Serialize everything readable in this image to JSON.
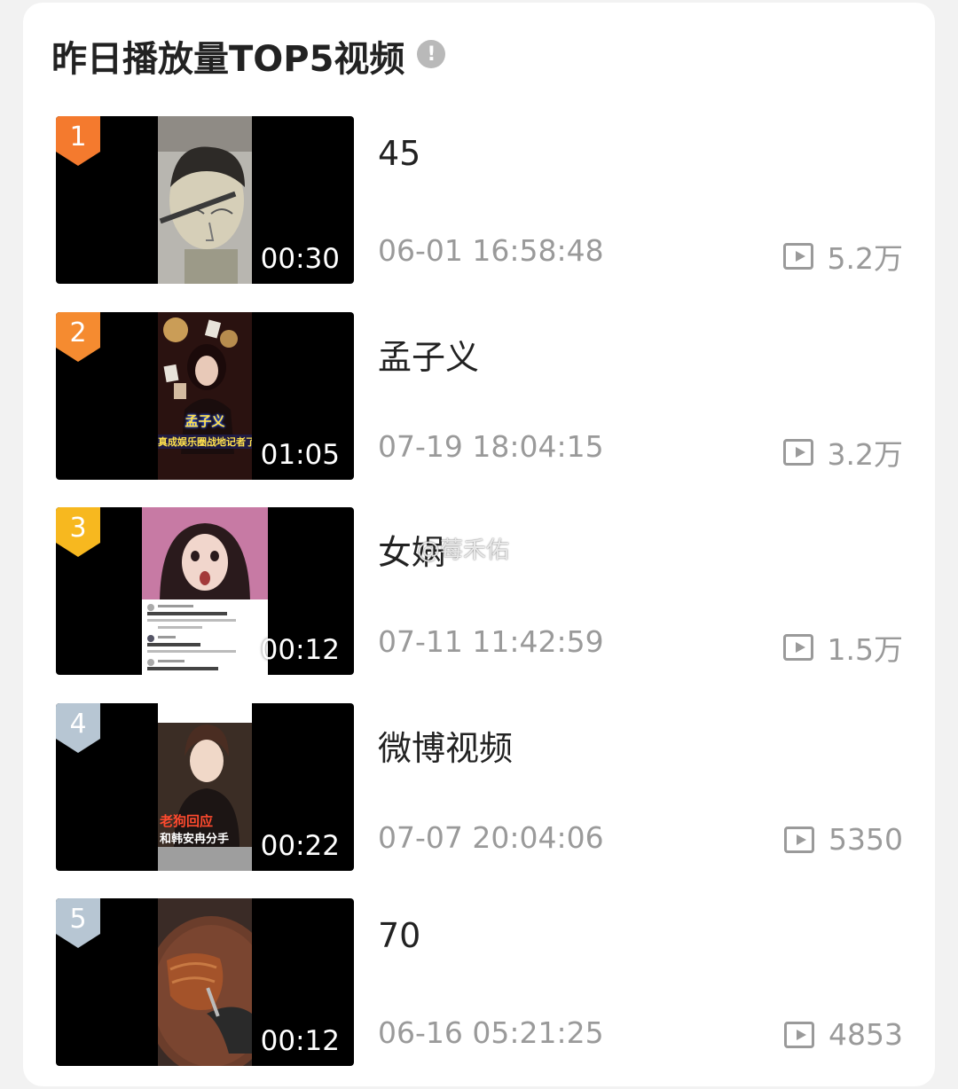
{
  "header": {
    "title": "昨日播放量TOP5视频",
    "info_icon_glyph": "!"
  },
  "colors": {
    "rank_1": "#f47a2e",
    "rank_2": "#f58b30",
    "rank_3": "#f7b81f",
    "rank_4": "#b7c6d3",
    "rank_5": "#b7c6d3",
    "meta_text": "#9a9a9a"
  },
  "videos": [
    {
      "rank": "1",
      "title": "45",
      "time": "06-01 16:58:48",
      "plays": "5.2万",
      "duration": "00:30",
      "thumb_icon": "haircut-mannequin-image"
    },
    {
      "rank": "2",
      "title": "孟子义",
      "time": "07-19 18:04:15",
      "plays": "3.2万",
      "duration": "01:05",
      "thumb_icon": "woman-casino-poster-image"
    },
    {
      "rank": "3",
      "title": "女娲",
      "time": "07-11 11:42:59",
      "plays": "1.5万",
      "duration": "00:12",
      "thumb_icon": "surprised-woman-comments-image"
    },
    {
      "rank": "4",
      "title": "微博视频",
      "time": "07-07 20:04:06",
      "plays": "5350",
      "duration": "00:22",
      "thumb_icon": "man-portrait-caption-image"
    },
    {
      "rank": "5",
      "title": "70",
      "time": "06-16 05:21:25",
      "plays": "4853",
      "duration": "00:12",
      "thumb_icon": "grilled-meat-board-image"
    }
  ],
  "thumb_captions": {
    "v2_line1": "孟子义",
    "v2_line2": "真成娱乐圈战地记者了",
    "v4_line1": "老狗回应",
    "v4_line2": "和韩安冉分手"
  },
  "watermark": "@莓禾佑"
}
